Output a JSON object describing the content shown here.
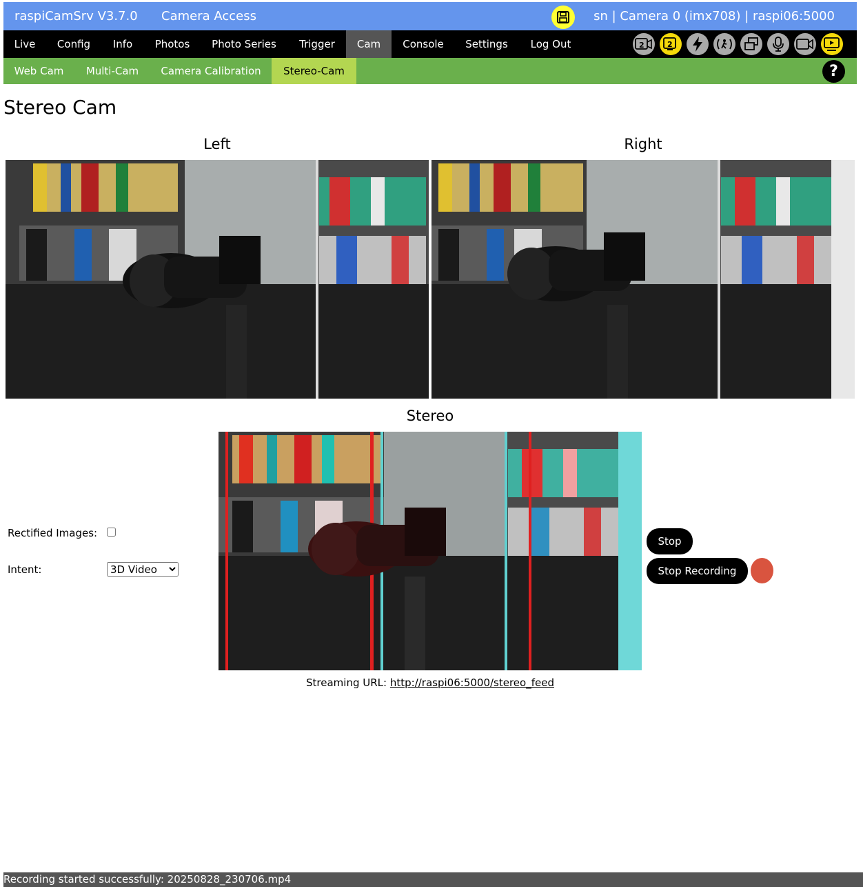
{
  "header": {
    "app_title": "raspiCamSrv V3.7.0",
    "section": "Camera Access",
    "info": "sn | Camera 0 (imx708) | raspi06:5000"
  },
  "nav": {
    "items": [
      "Live",
      "Config",
      "Info",
      "Photos",
      "Photo Series",
      "Trigger",
      "Cam",
      "Console",
      "Settings",
      "Log Out"
    ],
    "active": "Cam"
  },
  "status_icons": [
    {
      "name": "camera-2-icon",
      "text": "2",
      "active": false
    },
    {
      "name": "camera-2-active-icon",
      "text": "2",
      "active": true
    },
    {
      "name": "lightning-icon",
      "text": "⚡",
      "active": false
    },
    {
      "name": "motion-detect-icon",
      "text": "((·))",
      "active": false
    },
    {
      "name": "multi-window-icon",
      "text": "⧉",
      "active": false
    },
    {
      "name": "microphone-icon",
      "text": "🎙",
      "active": false
    },
    {
      "name": "video-camera-icon",
      "text": "▭",
      "active": false
    },
    {
      "name": "stream-display-icon",
      "text": "▶",
      "active": true
    }
  ],
  "subnav": {
    "items": [
      "Web Cam",
      "Multi-Cam",
      "Camera Calibration",
      "Stereo-Cam"
    ],
    "active": "Stereo-Cam",
    "help_label": "?"
  },
  "page_title": "Stereo Cam",
  "views": {
    "left_caption": "Left",
    "right_caption": "Right",
    "stereo_caption": "Stereo"
  },
  "controls": {
    "rectified_label": "Rectified Images:",
    "rectified_checked": false,
    "intent_label": "Intent:",
    "intent_value": "3D Video",
    "stop_label": "Stop",
    "stop_recording_label": "Stop Recording"
  },
  "streaming": {
    "label": "Streaming URL:",
    "url": "http://raspi06:5000/stereo_feed"
  },
  "status_message": "Recording started successfully: 20250828_230706.mp4",
  "colors": {
    "header_bg": "#6495ed",
    "nav_bg": "#000000",
    "subnav_bg": "#6ab04c",
    "subnav_active_bg": "#b3d651",
    "record_dot": "#d9543f",
    "statusbar_bg": "#555555"
  }
}
